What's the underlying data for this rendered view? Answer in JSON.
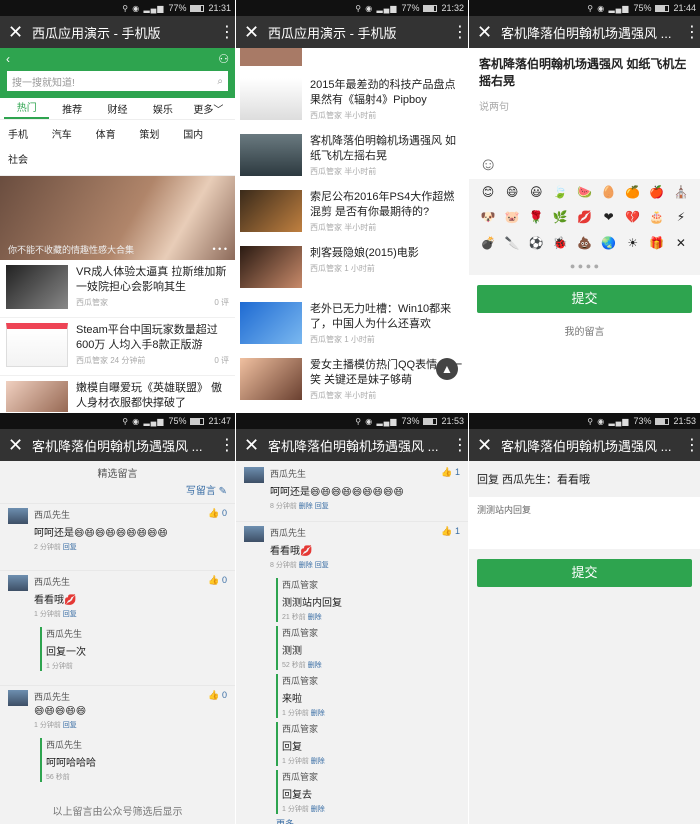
{
  "panel1": {
    "time": "21:31",
    "battery": "77%",
    "title": "西瓜应用演示 - 手机版",
    "search_placeholder": "搜一搜就知道!",
    "tabs": [
      "热门",
      "推荐",
      "财经",
      "娱乐",
      "更多"
    ],
    "categories": [
      "手机",
      "汽车",
      "体育",
      "策划",
      "国内",
      "社会"
    ],
    "hero_caption": "你不能不收藏的情趣性感大合集",
    "news": [
      {
        "title": "VR成人体验太逼真 拉斯维加斯一妓院担心会影响其生",
        "source": "西瓜管家",
        "count": "0 评"
      },
      {
        "title": "Steam平台中国玩家数量超过600万 人均入手8款正版游",
        "source": "西瓜管家",
        "time": "24 分钟前",
        "count": "0 评"
      },
      {
        "title": "嫩模自曝爱玩《英雄联盟》 傲人身材衣服都快撑破了",
        "source": "",
        "count": ""
      }
    ]
  },
  "panel2": {
    "time": "21:32",
    "battery": "77%",
    "title": "西瓜应用演示 - 手机版",
    "news": [
      {
        "title": "2015年最差劲的科技产品盘点 果然有《辐射4》Pipboy",
        "source": "西瓜管家",
        "time": "半小时前"
      },
      {
        "title": "客机降落伯明翰机场遇强风 如纸飞机左摇右晃",
        "source": "西瓜管家",
        "time": "半小时前"
      },
      {
        "title": "索尼公布2016年PS4大作超燃混剪 是否有你最期待的?",
        "source": "西瓜管家",
        "time": "半小时前"
      },
      {
        "title": "刺客聂隐娘(2015)电影",
        "source": "西瓜管家",
        "time": "1 小时前"
      },
      {
        "title": "老外已无力吐槽：Win10都来了，中国人为什么还喜欢",
        "source": "西瓜管家",
        "time": "1 小时前"
      },
      {
        "title": "爱女主播模仿热门QQ表情 君一笑 关键还是妹子够萌",
        "source": "西瓜管家",
        "time": "半小时前"
      }
    ]
  },
  "panel3": {
    "time": "21:44",
    "battery": "75%",
    "title": "客机降落伯明翰机场遇强风 ...",
    "article_title": "客机降落伯明翰机场遇强风 如纸飞机左摇右晃",
    "input_placeholder": "说两句",
    "emojis": [
      "😊",
      "😄",
      "😃",
      "🍃",
      "🍉",
      "🥚",
      "🍊",
      "🍎",
      "⛪",
      "🐶",
      "🐷",
      "🌹",
      "🌿",
      "💋",
      "❤",
      "💔",
      "🎂",
      "⚡",
      "💣",
      "🔪",
      "⚽",
      "🐞",
      "💩",
      "🌏",
      "☀",
      "🎁",
      "✕"
    ],
    "submit": "提交",
    "my_comments": "我的留言"
  },
  "panel4": {
    "time": "21:47",
    "battery": "75%",
    "title": "客机降落伯明翰机场遇强风 ...",
    "header": "精选留言",
    "write": "写留言",
    "comments": [
      {
        "name": "西瓜先生",
        "likes": "0",
        "text": "呵呵还是😄😄😄😄😄😄😄😄😄",
        "time": "2 分钟前",
        "action": "回复"
      },
      {
        "name": "西瓜先生",
        "likes": "0",
        "text": "看看哦💋",
        "time": "1 分钟前",
        "action": "回复",
        "reply": {
          "name": "西瓜先生",
          "text": "回复一次",
          "time": "1 分钟前"
        }
      },
      {
        "name": "西瓜先生",
        "likes": "0",
        "text": "😄😄😄😄😄",
        "time": "1 分钟前",
        "action": "回复",
        "reply": {
          "name": "西瓜先生",
          "text": "呵呵哈哈哈",
          "time": "56 秒前"
        }
      }
    ],
    "footer": "以上留言由公众号筛选后显示"
  },
  "panel5": {
    "time": "21:53",
    "battery": "73%",
    "title": "客机降落伯明翰机场遇强风 ...",
    "comments": [
      {
        "name": "西瓜先生",
        "likes": "1",
        "text": "呵呵还是😄😄😄😄😄😄😄😄😄",
        "time": "8 分钟前",
        "a1": "删除",
        "a2": "回复"
      },
      {
        "name": "西瓜先生",
        "likes": "1",
        "text": "看看哦💋",
        "time": "8 分钟前",
        "a1": "删除",
        "a2": "回复"
      }
    ],
    "replies": [
      {
        "name": "西瓜管家",
        "text": "测测站内回复",
        "time": "21 秒前",
        "action": "删除"
      },
      {
        "name": "西瓜管家",
        "text": "测测",
        "time": "52 秒前",
        "action": "删除"
      },
      {
        "name": "西瓜管家",
        "text": "来啦",
        "time": "1 分钟前",
        "action": "删除"
      },
      {
        "name": "西瓜管家",
        "text": "回复",
        "time": "1 分钟前",
        "action": "删除"
      },
      {
        "name": "西瓜管家",
        "text": "回复去",
        "time": "1 分钟前",
        "action": "删除"
      }
    ],
    "more": "更多"
  },
  "panel6": {
    "time": "21:53",
    "battery": "73%",
    "title": "客机降落伯明翰机场遇强风 ...",
    "reply_title": "回复 西瓜先生：看看哦",
    "input_value": "测测站内回复",
    "submit": "提交"
  },
  "colors": {
    "green": "#2ea44f",
    "appbar": "#333333",
    "link": "#3a6ea5"
  }
}
